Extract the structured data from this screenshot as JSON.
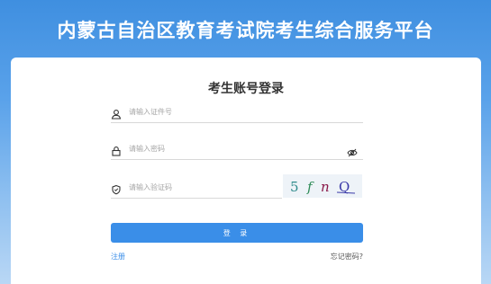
{
  "header": {
    "title": "内蒙古自治区教育考试院考生综合服务平台"
  },
  "login": {
    "title": "考生账号登录",
    "id_field": {
      "placeholder": "请输入证件号",
      "value": ""
    },
    "password_field": {
      "placeholder": "请输入密码",
      "value": ""
    },
    "captcha_field": {
      "placeholder": "请输入验证码",
      "value": ""
    },
    "captcha_image_text": "5 f n Q",
    "login_button": "登 录",
    "register_link": "注册",
    "forgot_link": "忘记密码?"
  },
  "colors": {
    "header_bg": "#4a95e4",
    "accent": "#3a8ee8"
  }
}
